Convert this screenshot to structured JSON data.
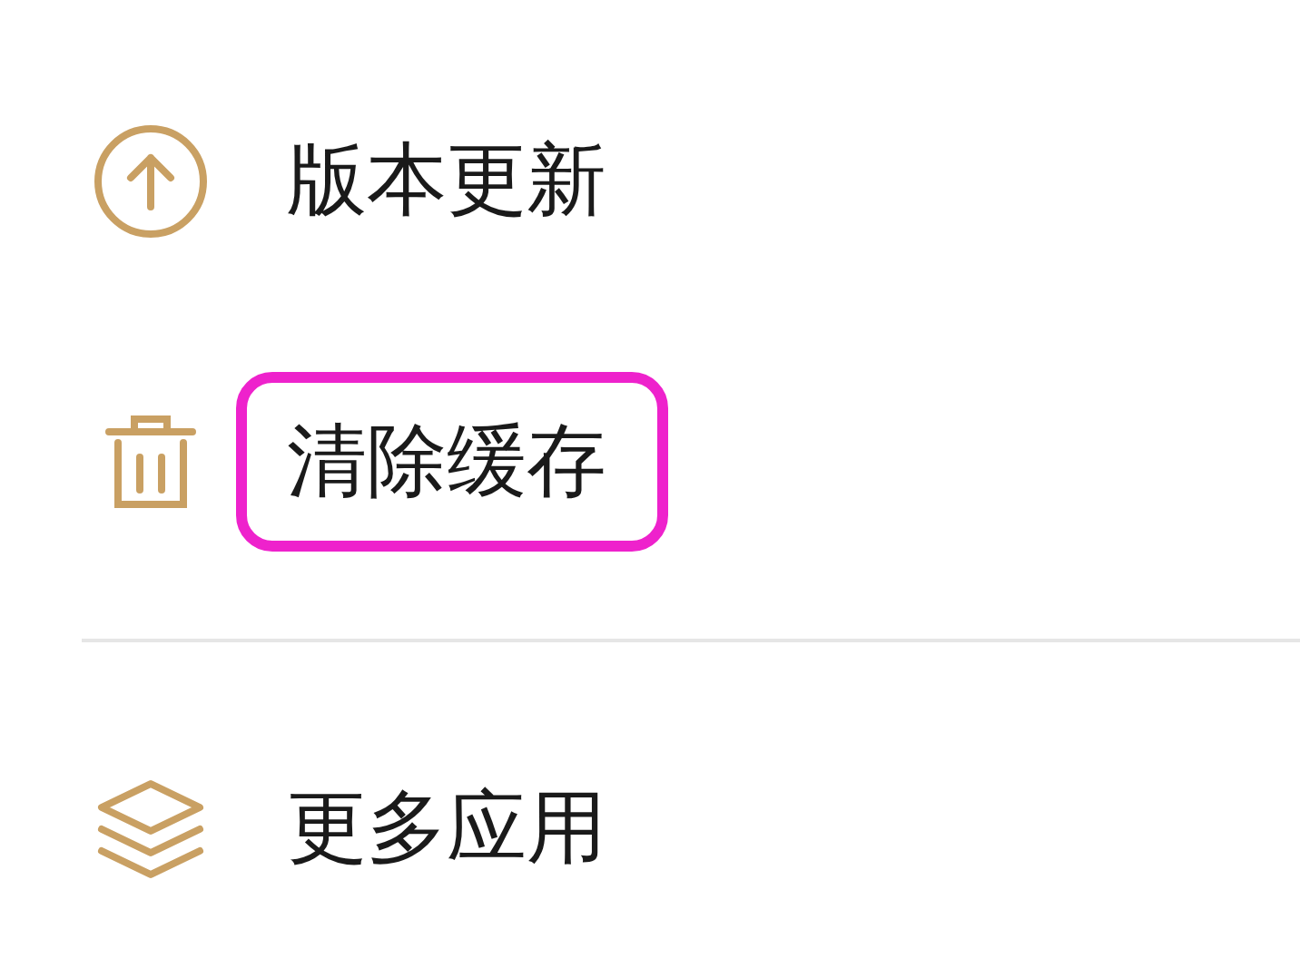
{
  "sections": [
    {
      "items": [
        {
          "kind": "update",
          "label": "版本更新",
          "highlighted": false
        },
        {
          "kind": "trash",
          "label": "清除缓存",
          "highlighted": true
        }
      ]
    },
    {
      "items": [
        {
          "kind": "layers",
          "label": "更多应用",
          "highlighted": false
        }
      ]
    }
  ]
}
